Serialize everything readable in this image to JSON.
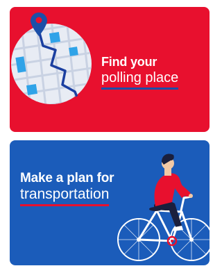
{
  "cards": [
    {
      "line1": "Find your",
      "line2": "polling place",
      "background": "#e8102e",
      "underline": "#1b4fa8",
      "illustration": "map-route-icon"
    },
    {
      "line1": "Make a plan for",
      "line2": "transportation",
      "background": "#1b5cba",
      "underline": "#e8102e",
      "illustration": "cyclist-icon"
    }
  ]
}
